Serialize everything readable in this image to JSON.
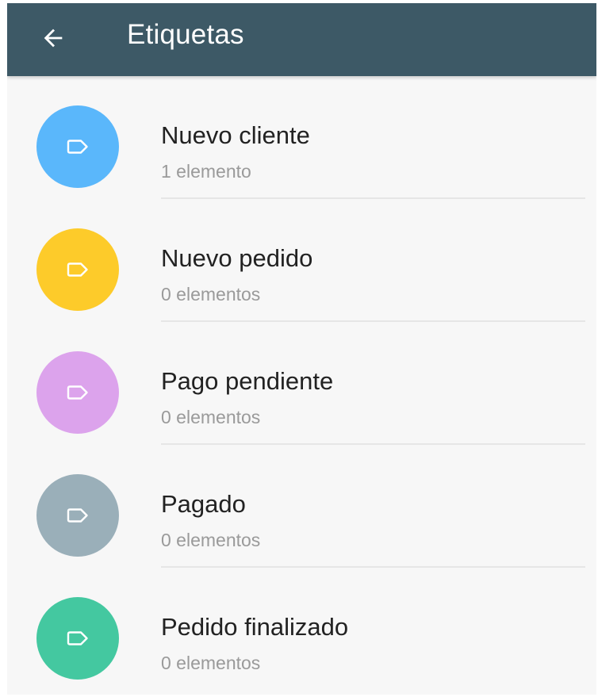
{
  "header": {
    "title": "Etiquetas",
    "back_icon": "arrow-left-icon",
    "background": "#3d5966"
  },
  "labels": [
    {
      "name": "Nuevo cliente",
      "count": "1 elemento",
      "color": "#5ab7fb",
      "icon": "label-tag-icon"
    },
    {
      "name": "Nuevo pedido",
      "count": "0 elementos",
      "color": "#fdcb2a",
      "icon": "label-tag-icon"
    },
    {
      "name": "Pago pendiente",
      "count": "0 elementos",
      "color": "#dca3ec",
      "icon": "label-tag-icon"
    },
    {
      "name": "Pagado",
      "count": "0 elementos",
      "color": "#9aafb9",
      "icon": "label-tag-icon"
    },
    {
      "name": "Pedido finalizado",
      "count": "0 elementos",
      "color": "#44c8a0",
      "icon": "label-tag-icon"
    }
  ]
}
